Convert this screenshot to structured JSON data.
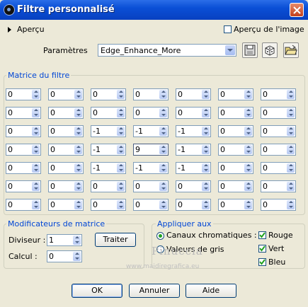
{
  "window": {
    "title": "Filtre personnalisé"
  },
  "preview": {
    "label": "Aperçu",
    "image_preview_label": "Aperçu de l'image",
    "image_preview_checked": false
  },
  "params": {
    "label": "Paramètres",
    "value": "Edge_Enhance_More",
    "icons": [
      "save-icon",
      "reset-dice-icon",
      "open-folder-icon"
    ]
  },
  "matrix": {
    "title": "Matrice du filtre",
    "rows": [
      [
        "0",
        "0",
        "0",
        "0",
        "0",
        "0",
        "0"
      ],
      [
        "0",
        "0",
        "0",
        "0",
        "0",
        "0",
        "0"
      ],
      [
        "0",
        "0",
        "-1",
        "-1",
        "-1",
        "0",
        "0"
      ],
      [
        "0",
        "0",
        "-1",
        "9",
        "-1",
        "0",
        "0"
      ],
      [
        "0",
        "0",
        "-1",
        "-1",
        "-1",
        "0",
        "0"
      ],
      [
        "0",
        "0",
        "0",
        "0",
        "0",
        "0",
        "0"
      ],
      [
        "0",
        "0",
        "0",
        "0",
        "0",
        "0",
        "0"
      ]
    ]
  },
  "modifiers": {
    "title": "Modificateurs de matrice",
    "divisor_label": "Diviseur :",
    "divisor_value": "1",
    "bias_label": "Calcul :",
    "bias_value": "0",
    "process_label": "Traiter"
  },
  "apply": {
    "title": "Appliquer aux",
    "options": [
      {
        "label": "Canaux chromatiques :",
        "selected": true
      },
      {
        "label": "Valeurs de gris",
        "selected": false
      }
    ],
    "channels": [
      {
        "label": "Rouge",
        "checked": true
      },
      {
        "label": "Vert",
        "checked": true
      },
      {
        "label": "Bleu",
        "checked": true
      }
    ]
  },
  "buttons": {
    "ok": "OK",
    "cancel": "Annuler",
    "help": "Aide"
  },
  "watermark": {
    "name": "Pinuccia",
    "site": "www.maidiregrafica.eu"
  }
}
